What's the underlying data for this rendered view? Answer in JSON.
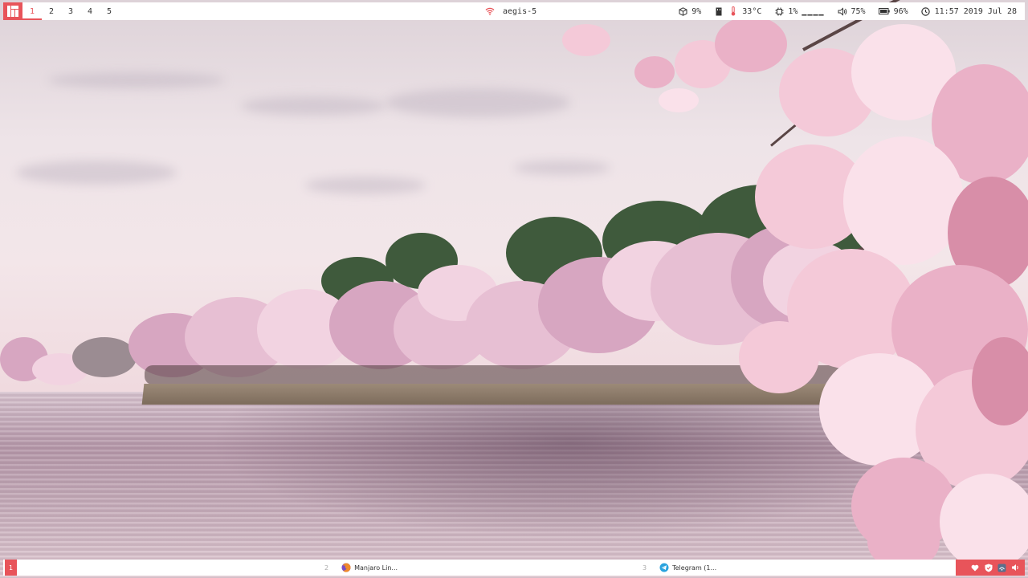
{
  "topbar": {
    "workspaces": [
      "1",
      "2",
      "3",
      "4",
      "5"
    ],
    "active_workspace": "1",
    "network_name": "aegis-5",
    "cpu": "9%",
    "temperature": "33°C",
    "memory": "1%",
    "disk_bars": "▁▁▁▁",
    "volume": "75%",
    "battery": "96%",
    "clock": "11:57 2019 Jul 28",
    "accent_color": "#e8545a"
  },
  "bottombar": {
    "workspace": "1",
    "tasks": [
      {
        "num": "2",
        "label": "Manjaro Lin...",
        "icon": "firefox-icon"
      },
      {
        "num": "3",
        "label": "Telegram (1...",
        "icon": "telegram-icon"
      }
    ],
    "tray_icons": [
      "heart-icon",
      "shield-icon",
      "network-icon",
      "speaker-icon"
    ]
  }
}
